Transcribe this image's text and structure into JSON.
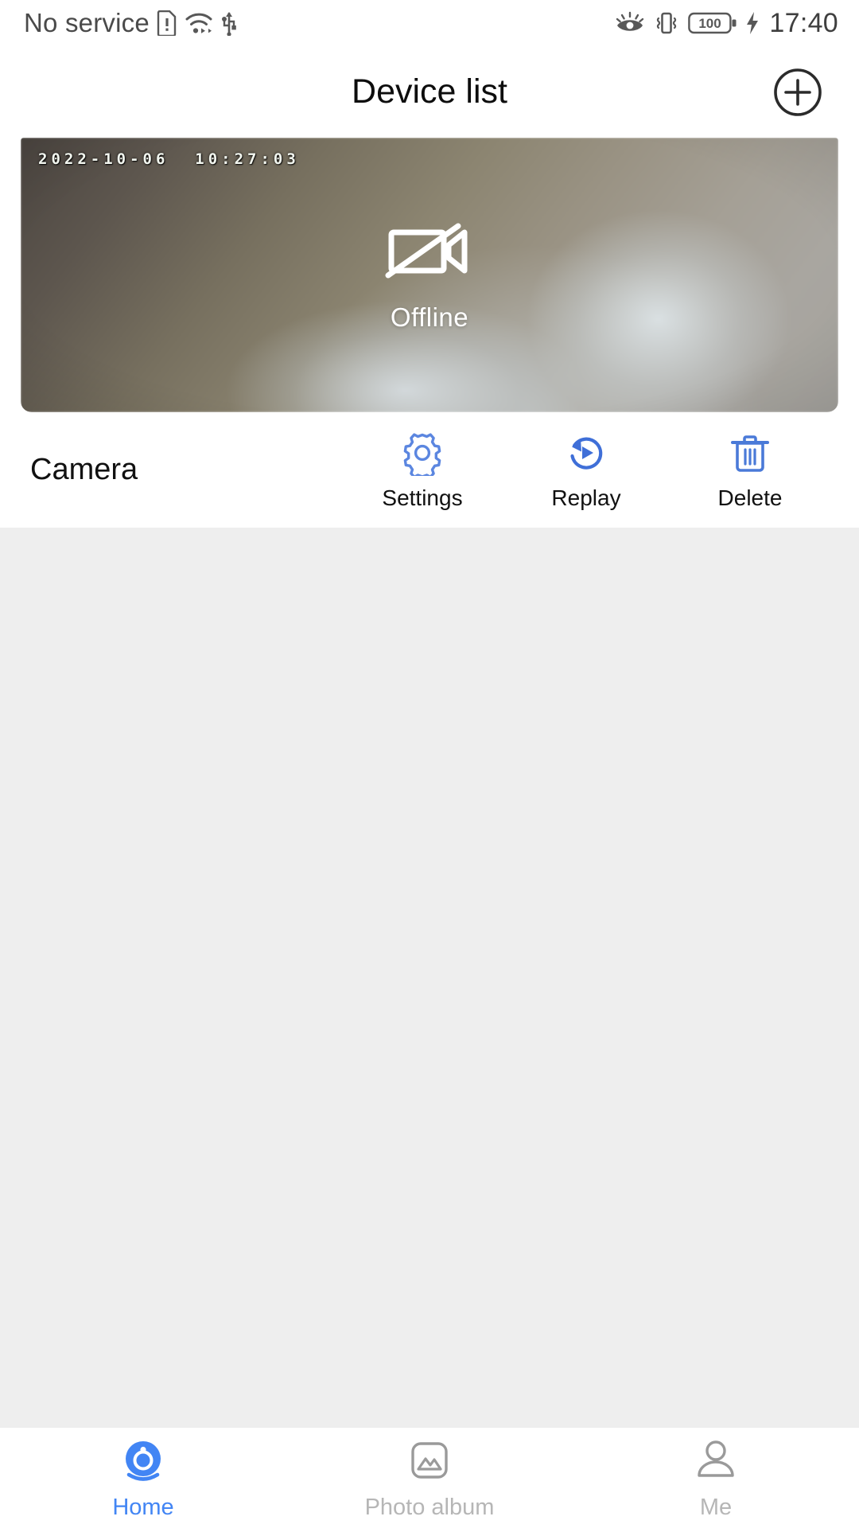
{
  "statusbar": {
    "carrier": "No service",
    "time": "17:40",
    "battery_level": "100",
    "icons": [
      "sim-card-alert-icon",
      "wifi-icon",
      "usb-icon",
      "eye-comfort-icon",
      "vibrate-icon",
      "battery-icon",
      "charging-bolt-icon"
    ]
  },
  "header": {
    "title": "Device list",
    "add_label": "add-device"
  },
  "device": {
    "name": "Camera",
    "preview": {
      "timestamp": "2022-10-06  10:27:03",
      "status_label": "Offline",
      "status_icon": "camera-off-icon"
    },
    "actions": [
      {
        "label": "Settings",
        "icon": "gear-icon"
      },
      {
        "label": "Replay",
        "icon": "replay-icon"
      },
      {
        "label": "Delete",
        "icon": "trash-icon"
      }
    ]
  },
  "bottom_nav": {
    "items": [
      {
        "label": "Home",
        "icon": "webcam-icon",
        "active": true
      },
      {
        "label": "Photo album",
        "icon": "image-icon",
        "active": false
      },
      {
        "label": "Me",
        "icon": "person-icon",
        "active": false
      }
    ]
  },
  "colors": {
    "accent": "#4285f4",
    "action_blue": "#5b86e0",
    "idle_gray": "#b6b6b6",
    "page_bg": "#eeeeee",
    "card_bg": "#ffffff"
  }
}
